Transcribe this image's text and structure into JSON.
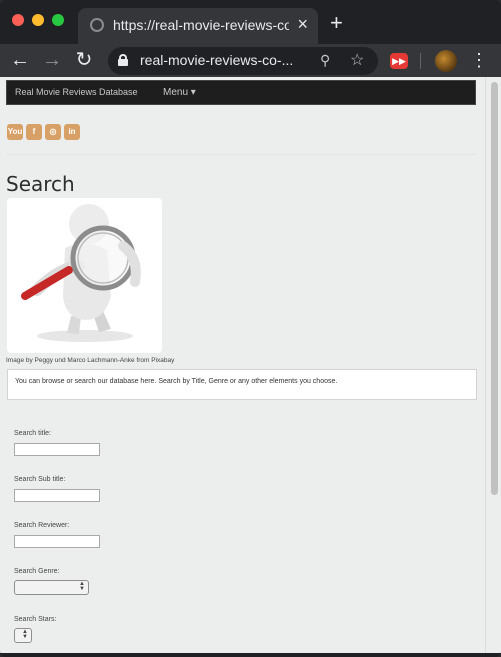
{
  "browser": {
    "tab_title": "https://real-movie-reviews-co-h",
    "tab_close": "×",
    "new_tab": "+",
    "url": "real-movie-reviews-co-...",
    "back": "←",
    "forward": "→",
    "reload": "↻",
    "zoom": "⚲",
    "star": "☆",
    "extension": "▶▶",
    "menu": "⋮"
  },
  "site": {
    "brand": "Real Movie Reviews Database",
    "menu": "Menu ▾",
    "social": [
      {
        "icon": "youtube-icon",
        "label": "You"
      },
      {
        "icon": "facebook-icon",
        "label": "f"
      },
      {
        "icon": "instagram-icon",
        "label": "◎"
      },
      {
        "icon": "linkedin-icon",
        "label": "in"
      }
    ],
    "colors": {
      "social": "#d7a066",
      "navbar": "#1e1e1e",
      "page_bg": "#eceeee"
    }
  },
  "main": {
    "title": "Search",
    "image_caption": "Image by Peggy und Marco Lachmann-Anke from Pixabay",
    "intro": "You can browse or search our database here. Search by Title, Genre or any other elements you choose."
  },
  "form": {
    "title_label": "Search title:",
    "title_value": "",
    "subtitle_label": "Search Sub title:",
    "subtitle_value": "",
    "reviewer_label": "Search Reviewer:",
    "reviewer_value": "",
    "genre_label": "Search Genre:",
    "genre_value": "",
    "stars_label": "Search Stars:",
    "stars_value": ""
  }
}
